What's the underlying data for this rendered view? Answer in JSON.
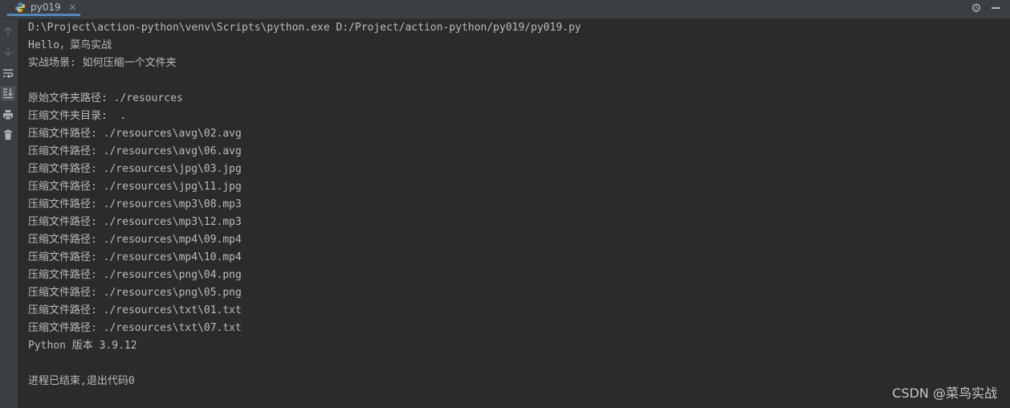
{
  "tab": {
    "label": "py019"
  },
  "console": {
    "lines": [
      "D:\\Project\\action-python\\venv\\Scripts\\python.exe D:/Project/action-python/py019/py019.py",
      "Hello，菜鸟实战",
      "实战场景: 如何压缩一个文件夹",
      "",
      "原始文件夹路径: ./resources",
      "压缩文件夹目录:  .",
      "压缩文件路径: ./resources\\avg\\02.avg",
      "压缩文件路径: ./resources\\avg\\06.avg",
      "压缩文件路径: ./resources\\jpg\\03.jpg",
      "压缩文件路径: ./resources\\jpg\\11.jpg",
      "压缩文件路径: ./resources\\mp3\\08.mp3",
      "压缩文件路径: ./resources\\mp3\\12.mp3",
      "压缩文件路径: ./resources\\mp4\\09.mp4",
      "压缩文件路径: ./resources\\mp4\\10.mp4",
      "压缩文件路径: ./resources\\png\\04.png",
      "压缩文件路径: ./resources\\png\\05.png",
      "压缩文件路径: ./resources\\txt\\01.txt",
      "压缩文件路径: ./resources\\txt\\07.txt",
      "Python 版本 3.9.12",
      "",
      "进程已结束,退出代码0"
    ]
  },
  "watermark": "CSDN @菜鸟实战",
  "icons": {
    "tab": "python-icon",
    "tab_close": "close-icon",
    "settings": "gear-icon",
    "hide": "minimize-icon",
    "tools": [
      "arrow-up-icon",
      "arrow-down-icon",
      "soft-wrap-icon",
      "scroll-to-end-icon",
      "print-icon",
      "trash-icon"
    ]
  },
  "colors": {
    "background": "#2b2b2b",
    "panel": "#3c3f41",
    "text": "#bbbbbb",
    "accent": "#4a88c7"
  }
}
